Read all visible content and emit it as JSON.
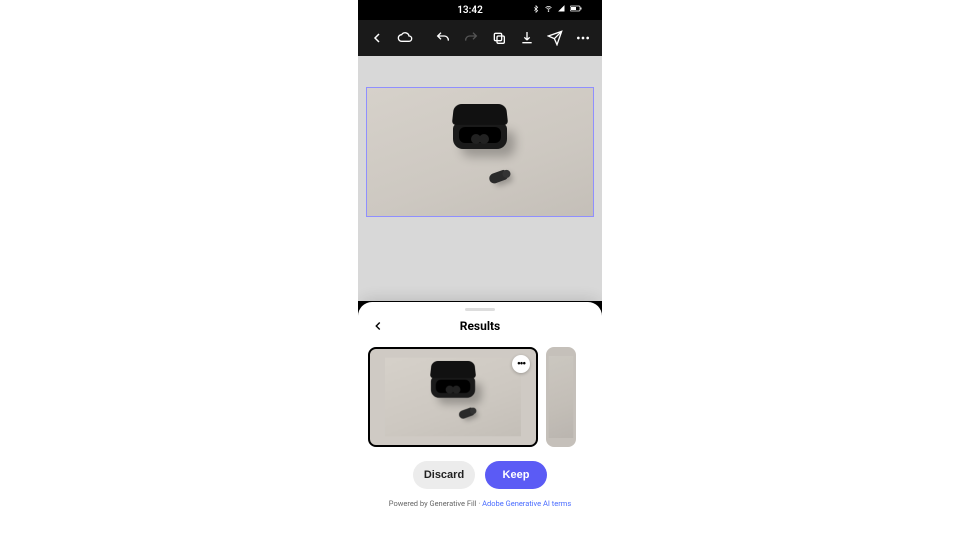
{
  "status": {
    "time": "13:42",
    "icons": [
      "bluetooth",
      "wifi",
      "signal",
      "battery"
    ]
  },
  "toolbar": {
    "back": "back",
    "cloud": "cloud",
    "undo": "undo",
    "redo": "redo",
    "layers": "layers",
    "download": "download",
    "share": "share",
    "more": "more"
  },
  "canvas": {
    "subject": "wireless-earbuds-case",
    "selection_border_color": "#8f8fff"
  },
  "sheet": {
    "title": "Results",
    "thumb_more": "•••",
    "discard_label": "Discard",
    "keep_label": "Keep"
  },
  "footer": {
    "prefix": "Powered by Generative Fill · ",
    "link_label": "Adobe Generative AI terms"
  }
}
